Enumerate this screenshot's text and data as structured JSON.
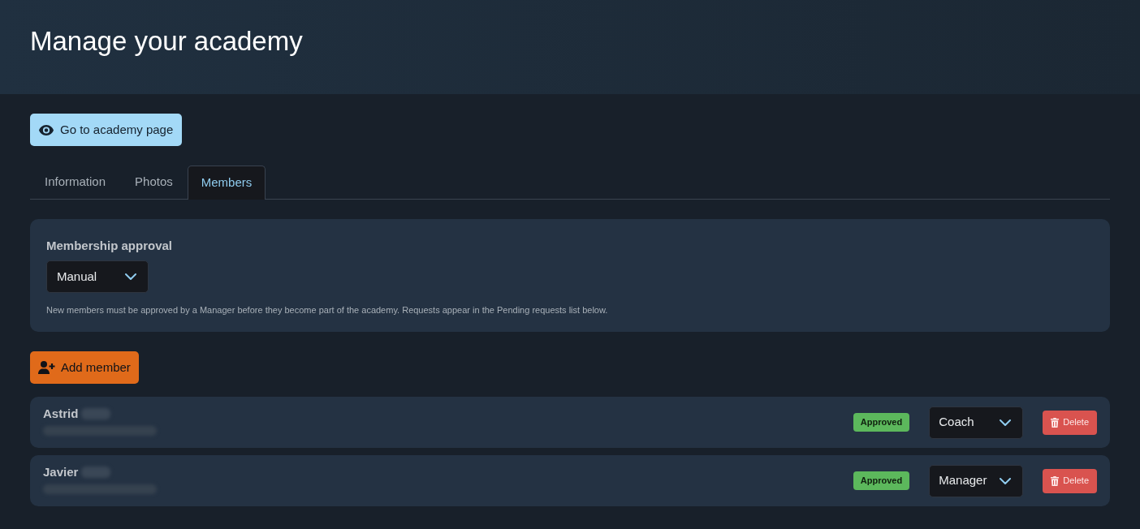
{
  "header": {
    "title": "Manage your academy"
  },
  "page_button": {
    "label": "Go to academy page"
  },
  "tabs": [
    {
      "label": "Information",
      "selected": false
    },
    {
      "label": "Photos",
      "selected": false
    },
    {
      "label": "Members",
      "selected": true
    }
  ],
  "membership_approval": {
    "label": "Membership approval",
    "value": "Manual",
    "help": "New members must be approved by a Manager before they become part of the academy. Requests appear in the Pending requests list below."
  },
  "add_member_button": {
    "label": "Add member"
  },
  "members": [
    {
      "name": "Astrid",
      "surname_blurred": true,
      "email_blurred": true,
      "status": "Approved",
      "role": "Coach",
      "delete_label": "Delete"
    },
    {
      "name": "Javier",
      "surname_blurred": true,
      "email_blurred": true,
      "status": "Approved",
      "role": "Manager",
      "delete_label": "Delete"
    }
  ]
}
